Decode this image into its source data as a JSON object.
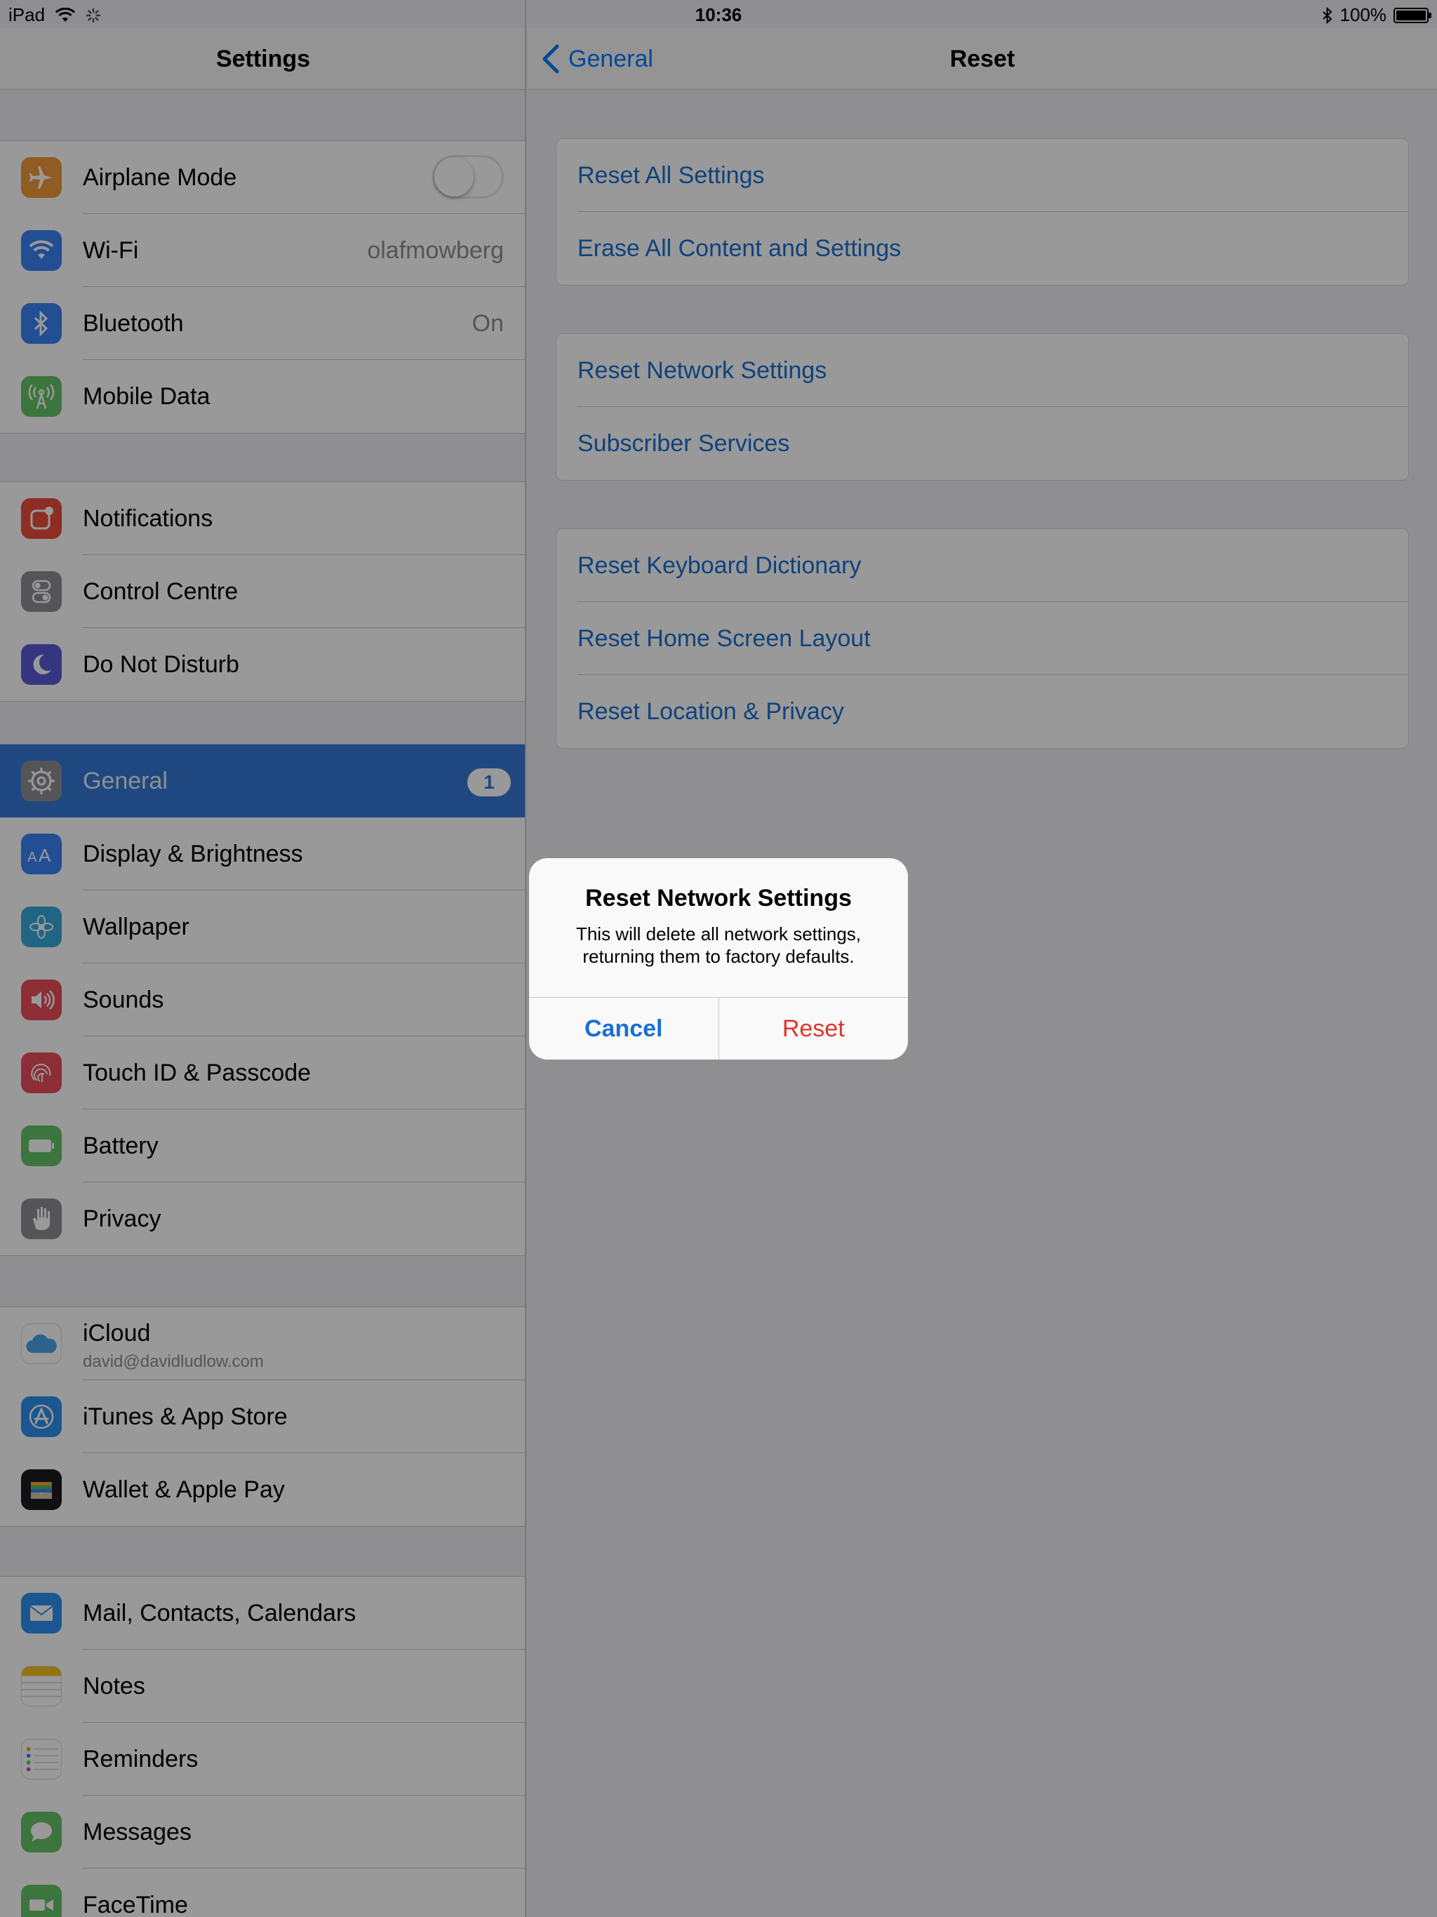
{
  "status_bar": {
    "device": "iPad",
    "time": "10:36",
    "battery": "100%",
    "battery_level": 1.0
  },
  "sidebar": {
    "title": "Settings",
    "groups": [
      [
        {
          "label": "Airplane Mode",
          "icon": "airplane-icon",
          "color": "#f19a37",
          "toggle": false
        },
        {
          "label": "Wi-Fi",
          "icon": "wifi-icon",
          "color": "#3a82f6",
          "value": "olafmowberg"
        },
        {
          "label": "Bluetooth",
          "icon": "bluetooth-icon",
          "color": "#3a82f6",
          "value": "On"
        },
        {
          "label": "Mobile Data",
          "icon": "antenna-icon",
          "color": "#65c466"
        }
      ],
      [
        {
          "label": "Notifications",
          "icon": "notifications-icon",
          "color": "#eb4d3d"
        },
        {
          "label": "Control Centre",
          "icon": "control-centre-icon",
          "color": "#8e8e93"
        },
        {
          "label": "Do Not Disturb",
          "icon": "moon-icon",
          "color": "#5b5bd6"
        }
      ],
      [
        {
          "label": "General",
          "icon": "gear-icon",
          "color": "#8e8e93",
          "badge": "1",
          "selected": true
        },
        {
          "label": "Display & Brightness",
          "icon": "display-icon",
          "color": "#3a82f6"
        },
        {
          "label": "Wallpaper",
          "icon": "wallpaper-icon",
          "color": "#36aadc"
        },
        {
          "label": "Sounds",
          "icon": "speaker-icon",
          "color": "#eb4d5d"
        },
        {
          "label": "Touch ID & Passcode",
          "icon": "fingerprint-icon",
          "color": "#eb4d5d"
        },
        {
          "label": "Battery",
          "icon": "battery-icon",
          "color": "#65c466"
        },
        {
          "label": "Privacy",
          "icon": "hand-icon",
          "color": "#8e8e93"
        }
      ],
      [
        {
          "label": "iCloud",
          "sublabel": "david@davidludlow.com",
          "icon": "icloud-icon",
          "color": "#ffffff"
        },
        {
          "label": "iTunes & App Store",
          "icon": "app-store-icon",
          "color": "#2d8ff0"
        },
        {
          "label": "Wallet & Apple Pay",
          "icon": "wallet-icon",
          "color": "#1c1c1e"
        }
      ],
      [
        {
          "label": "Mail, Contacts, Calendars",
          "icon": "mail-icon",
          "color": "#2d8ff0"
        },
        {
          "label": "Notes",
          "icon": "notes-icon",
          "color": "#ffffff"
        },
        {
          "label": "Reminders",
          "icon": "reminders-icon",
          "color": "#ffffff"
        },
        {
          "label": "Messages",
          "icon": "messages-icon",
          "color": "#65c466"
        },
        {
          "label": "FaceTime",
          "icon": "facetime-icon",
          "color": "#65c466"
        }
      ]
    ]
  },
  "detail": {
    "back_label": "General",
    "title": "Reset",
    "cards": [
      [
        "Reset All Settings",
        "Erase All Content and Settings"
      ],
      [
        "Reset Network Settings",
        "Subscriber Services"
      ],
      [
        "Reset Keyboard Dictionary",
        "Reset Home Screen Layout",
        "Reset Location & Privacy"
      ]
    ]
  },
  "alert": {
    "title": "Reset Network Settings",
    "message": "This will delete all network settings, returning them to factory defaults.",
    "cancel_label": "Cancel",
    "confirm_label": "Reset"
  },
  "colors": {
    "accent": "#007aff",
    "link": "#1a6fd1",
    "destructive": "#e0352b",
    "selection": "#3478d6"
  }
}
